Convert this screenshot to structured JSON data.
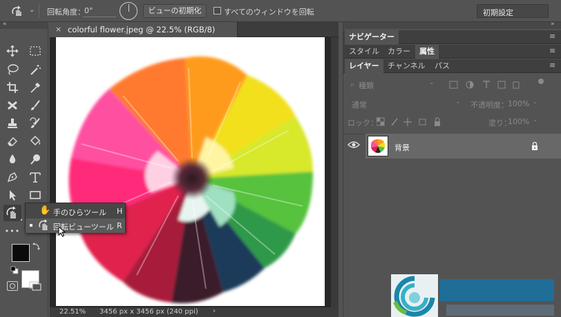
{
  "options_bar": {
    "rotation_label": "回転角度：",
    "rotation_value": "0°",
    "reset_view_button": "ビューの初期化",
    "rotate_all_windows_label": "すべてのウィンドウを回転",
    "workspace_select": "初期設定"
  },
  "document": {
    "tab_title": "colorful flower.jpeg @ 22.5% (RGB/8)",
    "close_glyph": "×"
  },
  "status_bar": {
    "zoom": "22.51%",
    "doc_info": "3456 px x 3456 px (240 ppi)",
    "arrow": "›"
  },
  "flyout": {
    "items": [
      {
        "label": "手のひらツール",
        "shortcut": "H"
      },
      {
        "label": "回転ビューツール",
        "shortcut": "R",
        "selected": true
      }
    ]
  },
  "panels": {
    "navigator_tab": "ナビゲーター",
    "style_tabs": [
      "スタイル",
      "カラー",
      "属性"
    ],
    "layer_tabs": [
      "レイヤー",
      "チャンネル",
      "パス"
    ],
    "kind_filter": "種類",
    "blend_mode": "通常",
    "opacity_label": "不透明度：",
    "opacity_value": "100%",
    "lock_label": "ロック：",
    "fill_label": "塗り：",
    "fill_value": "100%",
    "layer_name": "背景"
  },
  "toolbar": {
    "more_tools": "•••"
  }
}
